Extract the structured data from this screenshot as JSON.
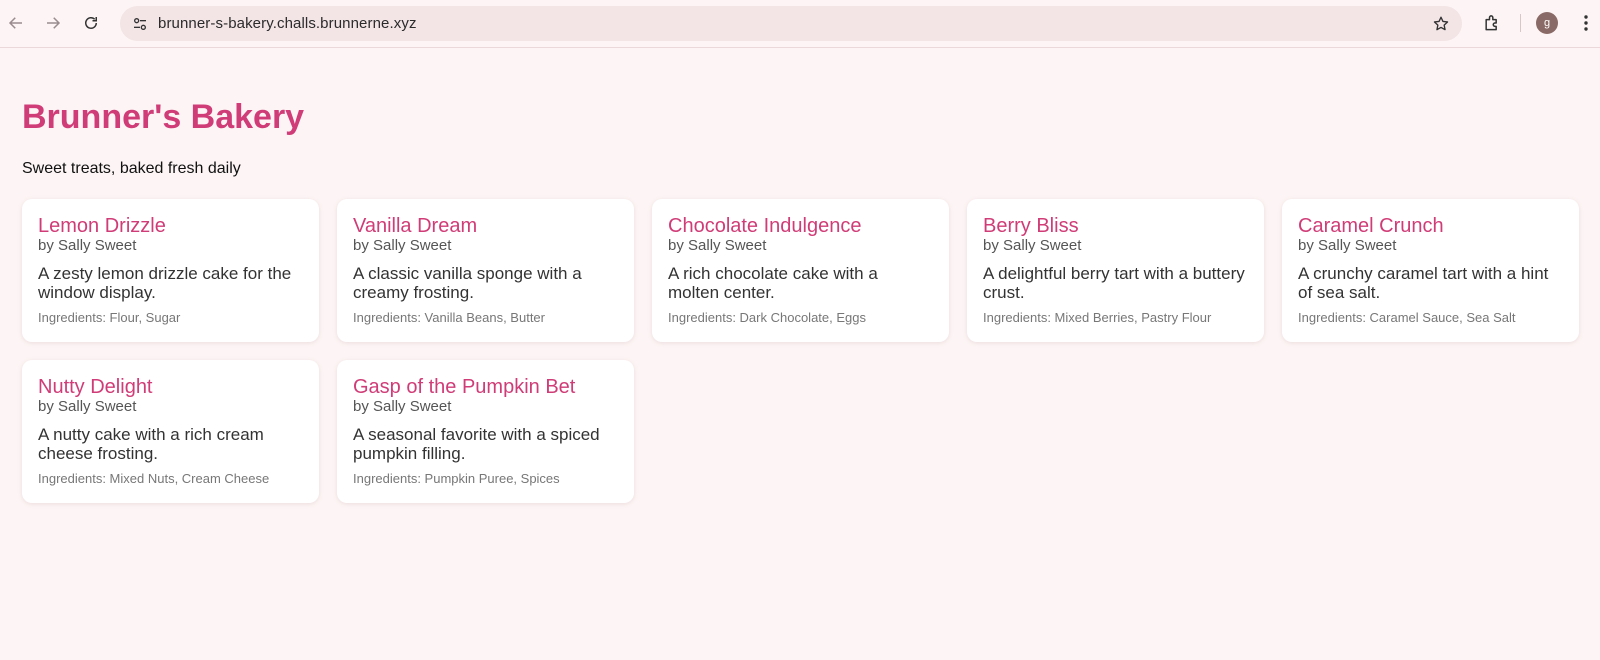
{
  "browser": {
    "url": "brunner-s-bakery.challs.brunnerne.xyz",
    "profile_initial": "g",
    "icons": [
      "back-icon",
      "forward-icon",
      "reload-icon",
      "site-settings-icon",
      "star-icon",
      "extensions-icon",
      "menu-icon"
    ]
  },
  "header": {
    "title": "Brunner's Bakery",
    "tagline": "Sweet treats, baked fresh daily"
  },
  "colors": {
    "accent": "#d03c77",
    "background": "#fdf5f5",
    "card": "#ffffff"
  },
  "recipes": [
    {
      "title": "Lemon Drizzle",
      "author": "by Sally Sweet",
      "description": "A zesty lemon drizzle cake for the window display.",
      "ingredients": "Ingredients: Flour, Sugar"
    },
    {
      "title": "Vanilla Dream",
      "author": "by Sally Sweet",
      "description": "A classic vanilla sponge with a creamy frosting.",
      "ingredients": "Ingredients: Vanilla Beans, Butter"
    },
    {
      "title": "Chocolate Indulgence",
      "author": "by Sally Sweet",
      "description": "A rich chocolate cake with a molten center.",
      "ingredients": "Ingredients: Dark Chocolate, Eggs"
    },
    {
      "title": "Berry Bliss",
      "author": "by Sally Sweet",
      "description": "A delightful berry tart with a buttery crust.",
      "ingredients": "Ingredients: Mixed Berries, Pastry Flour"
    },
    {
      "title": "Caramel Crunch",
      "author": "by Sally Sweet",
      "description": "A crunchy caramel tart with a hint of sea salt.",
      "ingredients": "Ingredients: Caramel Sauce, Sea Salt"
    },
    {
      "title": "Nutty Delight",
      "author": "by Sally Sweet",
      "description": "A nutty cake with a rich cream cheese frosting.",
      "ingredients": "Ingredients: Mixed Nuts, Cream Cheese"
    },
    {
      "title": "Gasp of the Pumpkin Bet",
      "author": "by Sally Sweet",
      "description": "A seasonal favorite with a spiced pumpkin filling.",
      "ingredients": "Ingredients: Pumpkin Puree, Spices"
    }
  ]
}
